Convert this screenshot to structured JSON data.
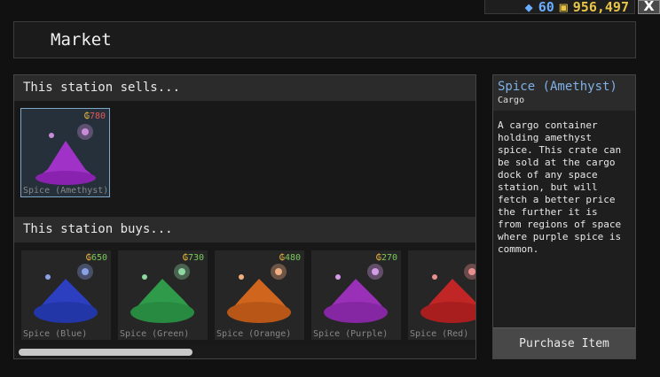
{
  "currency": {
    "gems": "60",
    "credits": "956,497"
  },
  "window": {
    "close_label": "X",
    "title": "Market"
  },
  "sells": {
    "header": "This station sells...",
    "items": [
      {
        "name": "Spice (Amethyst)",
        "price": "780",
        "color": "#a032c8",
        "price_color": "#e05a5a"
      }
    ]
  },
  "buys": {
    "header": "This station buys...",
    "items": [
      {
        "name": "Spice (Blue)",
        "price": "650",
        "color": "#2b3fc0",
        "price_color": "#7acb5a"
      },
      {
        "name": "Spice (Green)",
        "price": "730",
        "color": "#2f9a4a",
        "price_color": "#7acb5a"
      },
      {
        "name": "Spice (Orange)",
        "price": "480",
        "color": "#d0651e",
        "price_color": "#7acb5a"
      },
      {
        "name": "Spice (Purple)",
        "price": "270",
        "color": "#9a2fb8",
        "price_color": "#7acb5a"
      },
      {
        "name": "Spice (Red)",
        "price": "",
        "color": "#c02626",
        "price_color": "#7acb5a"
      }
    ]
  },
  "details": {
    "title": "Spice (Amethyst)",
    "category": "Cargo",
    "description": "A cargo container\nholding amethyst\nspice. This crate can\nbe sold at the cargo\ndock of any space\nstation, but will\nfetch a better price\nthe further it is\nfrom regions of space\nwhere purple spice is\ncommon.",
    "purchase_label": "Purchase Item"
  }
}
